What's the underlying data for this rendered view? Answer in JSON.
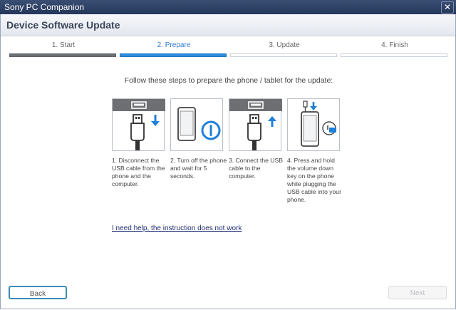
{
  "app": {
    "title": "Sony PC Companion",
    "close_glyph": "✕"
  },
  "header": {
    "title": "Device Software Update"
  },
  "steps": [
    {
      "label": "1. Start",
      "state": "done"
    },
    {
      "label": "2. Prepare",
      "state": "active"
    },
    {
      "label": "3. Update",
      "state": "todo"
    },
    {
      "label": "4. Finish",
      "state": "todo"
    }
  ],
  "main": {
    "instruction": "Follow these steps to prepare the phone / tablet for the update:",
    "panels": [
      {
        "icon": "usb-disconnect-icon",
        "caption": "1. Disconnect the USB cable from the phone and the computer."
      },
      {
        "icon": "phone-power-off-icon",
        "caption": "2. Turn off the phone and wait for 5 seconds."
      },
      {
        "icon": "usb-connect-icon",
        "caption": "3. Connect the USB cable to the computer."
      },
      {
        "icon": "volume-down-plug-icon",
        "caption": "4. Press and hold the volume down key on the phone while plugging the USB cable into your phone."
      }
    ],
    "help_link": "I need help, the instruction does not work"
  },
  "footer": {
    "back_label": "Back",
    "next_label": "Next"
  },
  "colors": {
    "accent": "#2f8bde",
    "title_bar": "#2c3f63",
    "progress_done": "#6b6f76"
  }
}
